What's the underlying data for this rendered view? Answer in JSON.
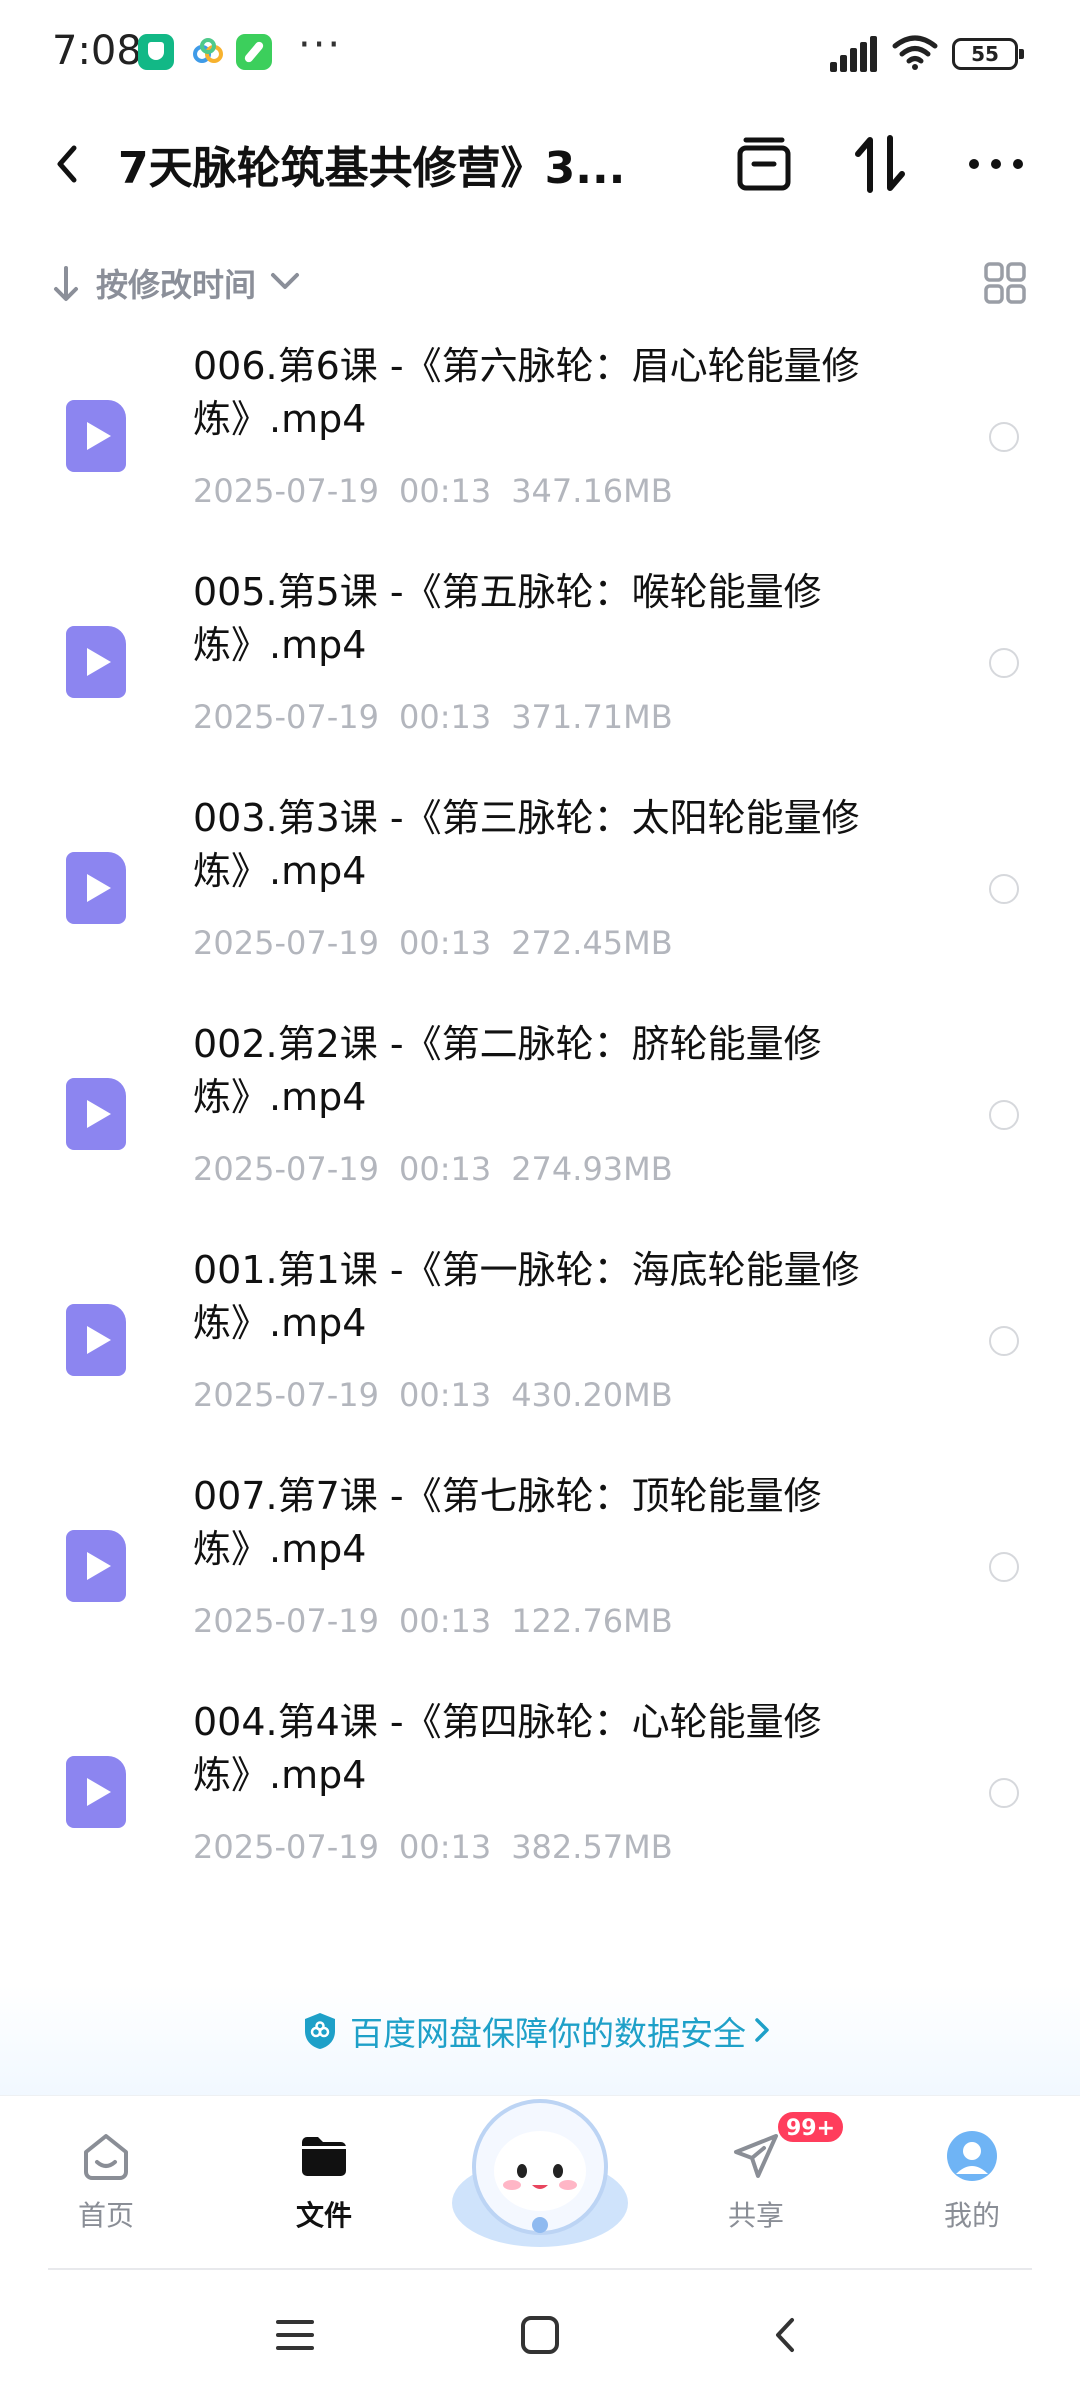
{
  "status_bar": {
    "time": "7:08",
    "battery": "55",
    "more": "···"
  },
  "header": {
    "title": "7天脉轮筑基共修营》3..."
  },
  "sort": {
    "label": "按修改时间"
  },
  "files": [
    {
      "name": "006.第6课 -《第六脉轮：眉心轮能量修炼》.mp4",
      "date": "2025-07-19",
      "time": "00:13",
      "size": "347.16MB"
    },
    {
      "name": "005.第5课 -《第五脉轮：喉轮能量修炼》.mp4",
      "date": "2025-07-19",
      "time": "00:13",
      "size": "371.71MB"
    },
    {
      "name": "003.第3课 -《第三脉轮：太阳轮能量修炼》.mp4",
      "date": "2025-07-19",
      "time": "00:13",
      "size": "272.45MB"
    },
    {
      "name": "002.第2课 -《第二脉轮：脐轮能量修炼》.mp4",
      "date": "2025-07-19",
      "time": "00:13",
      "size": "274.93MB"
    },
    {
      "name": "001.第1课 -《第一脉轮：海底轮能量修炼》.mp4",
      "date": "2025-07-19",
      "time": "00:13",
      "size": "430.20MB"
    },
    {
      "name": "007.第7课 -《第七脉轮：顶轮能量修炼》.mp4",
      "date": "2025-07-19",
      "time": "00:13",
      "size": "122.76MB"
    },
    {
      "name": "004.第4课 -《第四脉轮：心轮能量修炼》.mp4",
      "date": "2025-07-19",
      "time": "00:13",
      "size": "382.57MB"
    }
  ],
  "banner": {
    "text": "百度网盘保障你的数据安全"
  },
  "tabs": {
    "home": "首页",
    "files": "文件",
    "share": "共享",
    "me": "我的",
    "share_badge": "99+"
  },
  "colors": {
    "video_icon": "#8c85f0",
    "banner_text": "#1ea0c8",
    "badge": "#ff3d5c"
  },
  "icons": {
    "header": [
      "back-icon",
      "archive-icon",
      "sort-swap-icon",
      "more-icon"
    ],
    "tabs": [
      "home-icon",
      "folder-icon",
      "paper-plane-icon",
      "avatar-icon"
    ],
    "nav": [
      "menu-icon",
      "square-icon",
      "back-triangle-icon"
    ]
  }
}
